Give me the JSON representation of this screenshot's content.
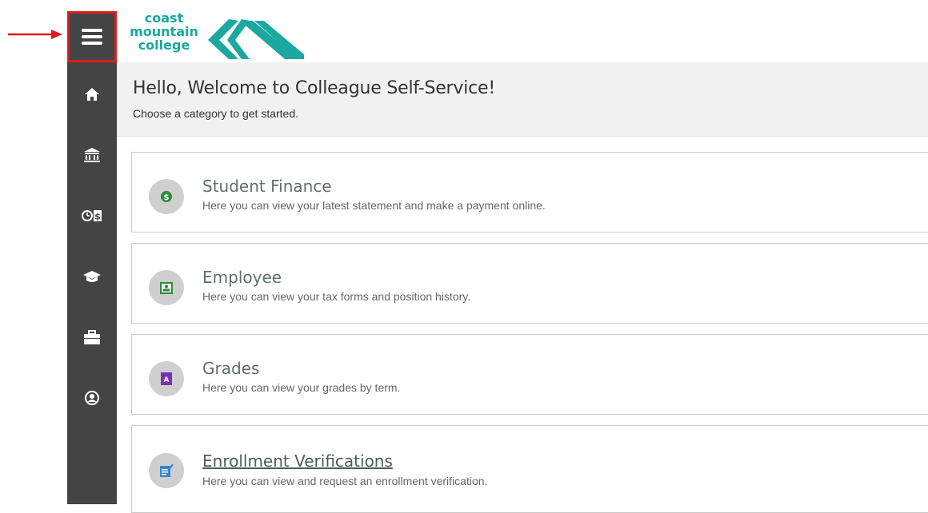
{
  "header": {
    "logo_lines": [
      "coast",
      "mountain",
      "college"
    ],
    "brand_color": "#1aa8a0"
  },
  "sidebar": {
    "menu_icon": "hamburger-icon",
    "highlight_color": "#e01b1b",
    "items": [
      {
        "icon": "home-icon"
      },
      {
        "icon": "bank-icon"
      },
      {
        "icon": "clock-dollar-icon"
      },
      {
        "icon": "graduation-cap-icon"
      },
      {
        "icon": "briefcase-icon"
      },
      {
        "icon": "user-circle-icon"
      }
    ]
  },
  "welcome": {
    "title": "Hello, Welcome to Colleague Self-Service!",
    "subtitle": "Choose a category to get started."
  },
  "categories": [
    {
      "title": "Student Finance",
      "description": "Here you can view your latest statement and make a payment online.",
      "icon": "dollar-icon"
    },
    {
      "title": "Employee",
      "description": "Here you can view your tax forms and position history.",
      "icon": "id-badge-icon"
    },
    {
      "title": "Grades",
      "description": "Here you can view your grades by term.",
      "icon": "grade-a-icon"
    },
    {
      "title": "Enrollment Verifications",
      "description": "Here you can view and request an enrollment verification.",
      "icon": "verification-icon"
    }
  ]
}
